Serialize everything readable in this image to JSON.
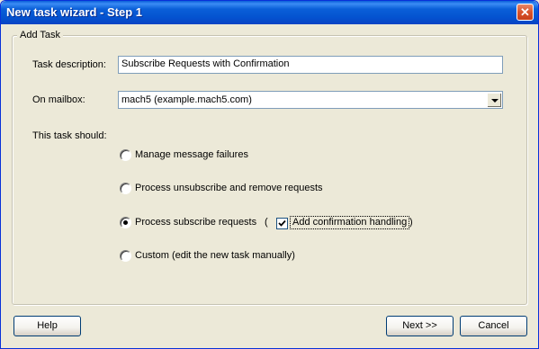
{
  "window": {
    "title": "New task wizard - Step 1"
  },
  "group": {
    "title": "Add Task"
  },
  "form": {
    "task_description_label": "Task description:",
    "task_description_value": "Subscribe Requests with Confirmation",
    "mailbox_label": "On mailbox:",
    "mailbox_value": "mach5 (example.mach5.com)",
    "task_should_label": "This task should:"
  },
  "options": [
    {
      "label": "Manage message failures",
      "selected": false
    },
    {
      "label": "Process unsubscribe and remove requests",
      "selected": false
    },
    {
      "label": "Process subscribe requests",
      "selected": true
    },
    {
      "label": "Custom (edit the new task manually)",
      "selected": false
    }
  ],
  "confirmation": {
    "open_paren": "(",
    "label": "Add confirmation handling",
    "close_paren": ")",
    "checked": true
  },
  "buttons": {
    "help": "Help",
    "next": "Next >>",
    "cancel": "Cancel"
  }
}
